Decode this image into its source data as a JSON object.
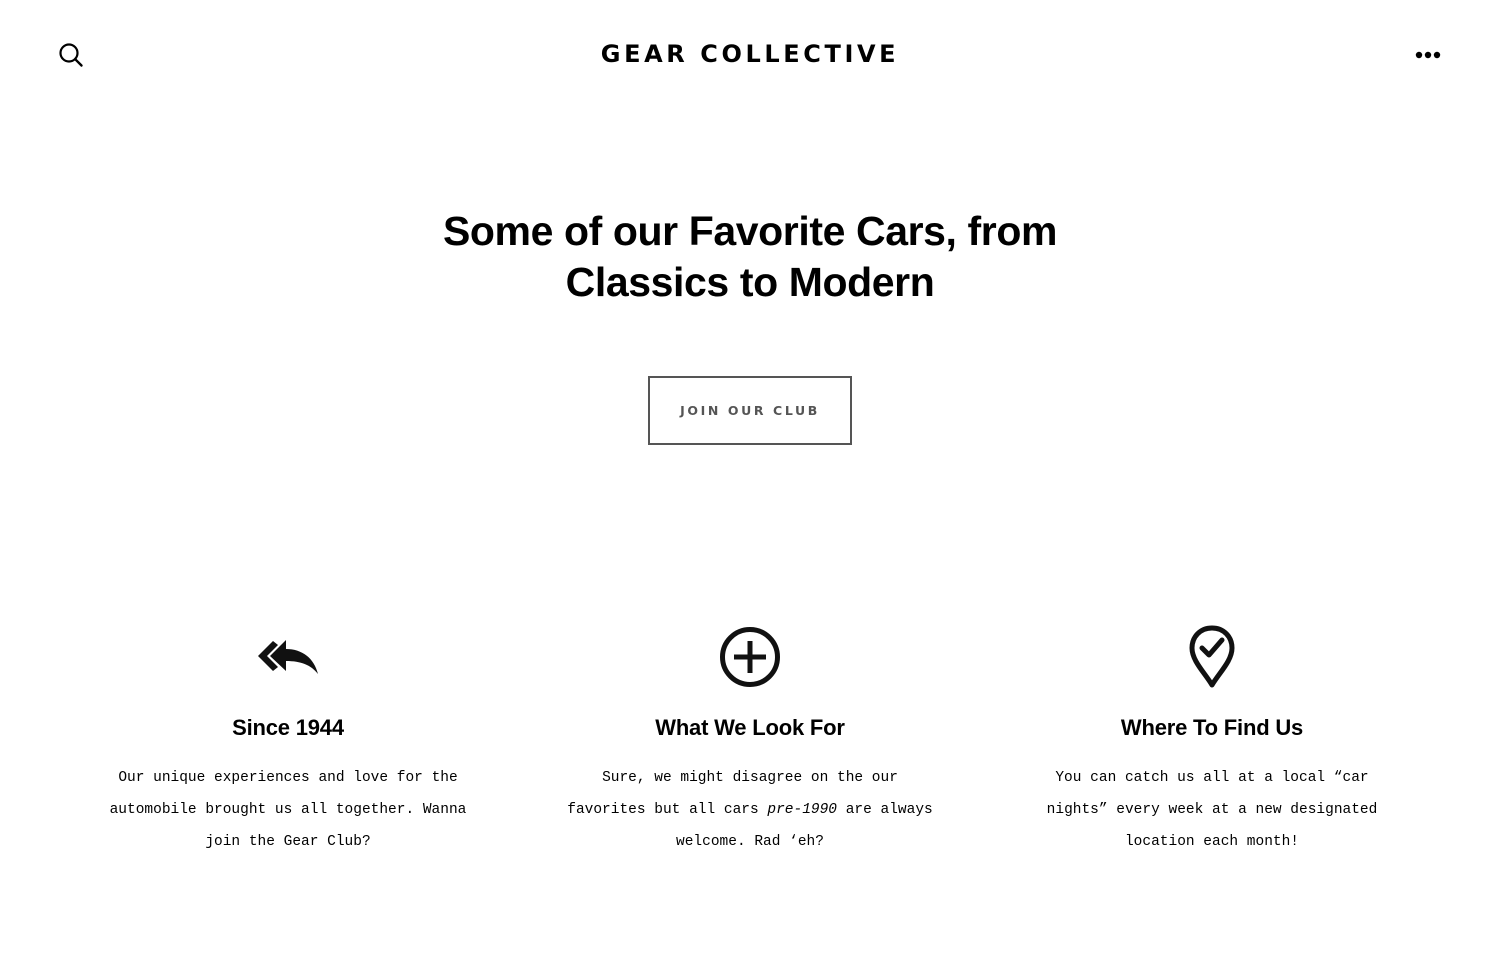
{
  "header": {
    "site_title": "GEAR COLLECTIVE",
    "search_icon": "search-icon",
    "menu_icon": "more-horizontal-icon"
  },
  "hero": {
    "heading_line_1": "Some of our Favorite Cars, from",
    "heading_line_2": "Classics to Modern",
    "button_label": "JOIN OUR CLUB"
  },
  "features": [
    {
      "icon": "reply-all-icon",
      "title": "Since 1944",
      "text_line_1": "Our unique experiences and love for the",
      "text_line_2": "automobile brought us all together. Wanna",
      "text_line_3": "join the Gear Club?"
    },
    {
      "icon": "plus-circle-icon",
      "title": "What We Look For",
      "text_line_1": "Sure, we might disagree on the our",
      "text_line_2_before": "favorites but all cars ",
      "text_line_2_emphasis": "pre-1990",
      "text_line_2_after": " are always",
      "text_line_3": "welcome. Rad ‘eh?"
    },
    {
      "icon": "map-pin-check-icon",
      "title": "Where To Find Us",
      "text_line_1": "You can catch us all at a local “car",
      "text_line_2": "nights” every week at a new designated",
      "text_line_3": "location each month!"
    }
  ],
  "colors": {
    "text": "#000000",
    "button_border": "#555555",
    "background": "#ffffff"
  }
}
